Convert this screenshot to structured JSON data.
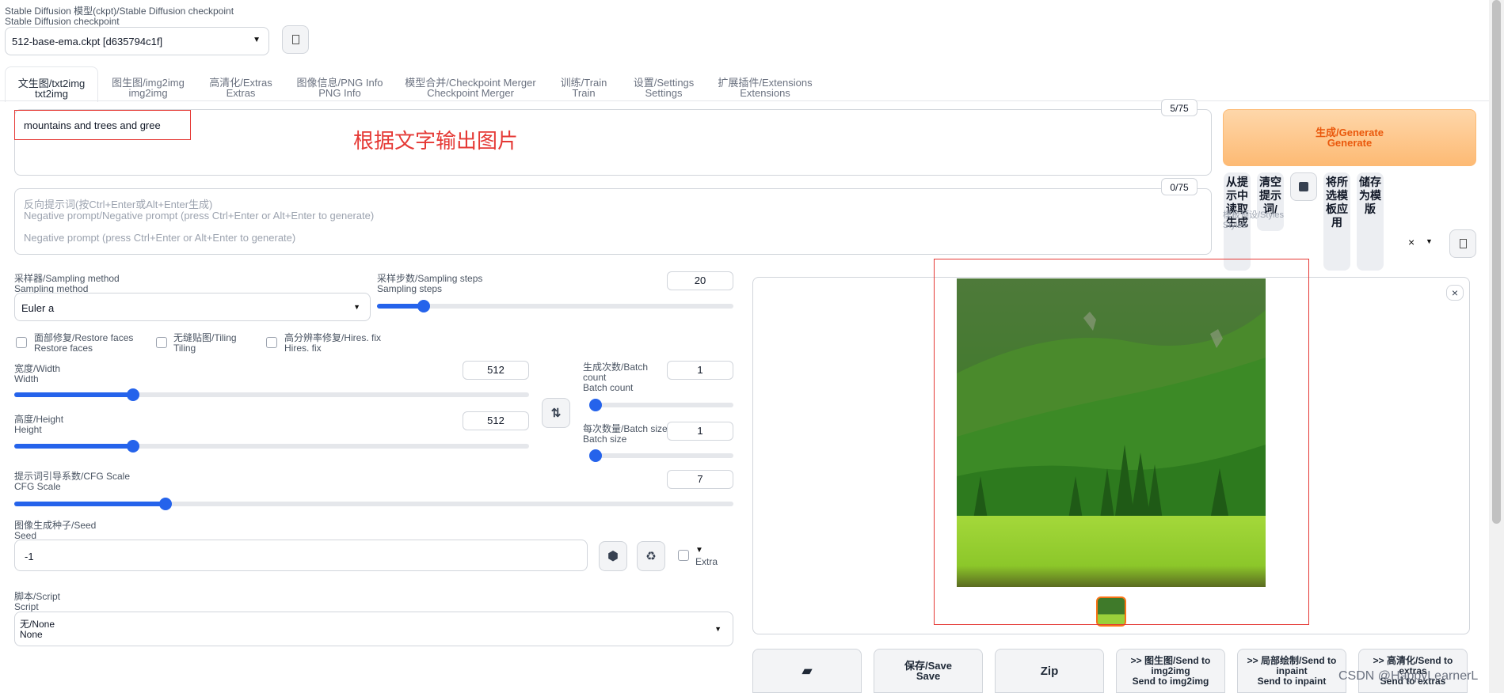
{
  "checkpoint": {
    "label_cn": "Stable Diffusion 模型(ckpt)/Stable Diffusion checkpoint",
    "label_en": "Stable Diffusion checkpoint",
    "value": "512-base-ema.ckpt [d635794c1f]"
  },
  "tabs": [
    {
      "cn": "文生图/txt2img",
      "en": "txt2img"
    },
    {
      "cn": "图生图/img2img",
      "en": "img2img"
    },
    {
      "cn": "高清化/Extras",
      "en": "Extras"
    },
    {
      "cn": "图像信息/PNG Info",
      "en": "PNG Info"
    },
    {
      "cn": "模型合并/Checkpoint Merger",
      "en": "Checkpoint Merger"
    },
    {
      "cn": "训练/Train",
      "en": "Train"
    },
    {
      "cn": "设置/Settings",
      "en": "Settings"
    },
    {
      "cn": "扩展插件/Extensions",
      "en": "Extensions"
    }
  ],
  "prompt": {
    "value": "mountains and trees and gree",
    "counter": "5/75",
    "annotation": "根据文字输出图片"
  },
  "negative_prompt": {
    "counter": "0/75",
    "ph1": "反向提示词(按Ctrl+Enter或Alt+Enter生成)",
    "ph2": "Negative prompt/Negative prompt (press Ctrl+Enter or Alt+Enter to generate)",
    "ph3": "Negative prompt (press Ctrl+Enter or Alt+Enter to generate)"
  },
  "generate": {
    "cn": "生成/Generate",
    "en": "Generate"
  },
  "tool_buttons": {
    "from_prompt": "从提示中读取生成",
    "clear": "清空提示词/",
    "apply_style": "将所选模板应用",
    "save_style": "储存为模版"
  },
  "styles": {
    "label_cn": "模板预设/Styles",
    "label_en": "Styles",
    "clear": "×"
  },
  "sampling": {
    "method_label_cn": "采样器/Sampling method",
    "method_label_en": "Sampling method",
    "method_value": "Euler a",
    "steps_label_cn": "采样步数/Sampling steps",
    "steps_label_en": "Sampling steps",
    "steps_value": "20",
    "steps_fraction": 0.13
  },
  "checkboxes": [
    {
      "cn": "面部修复/Restore faces",
      "en": "Restore faces"
    },
    {
      "cn": "无缝贴图/Tiling",
      "en": "Tiling"
    },
    {
      "cn": "高分辨率修复/Hires. fix",
      "en": "Hires. fix"
    }
  ],
  "width": {
    "label_cn": "宽度/Width",
    "label_en": "Width",
    "value": "512",
    "fraction": 0.23
  },
  "height": {
    "label_cn": "高度/Height",
    "label_en": "Height",
    "value": "512",
    "fraction": 0.23
  },
  "batch_count": {
    "label_cn": "生成次数/Batch count",
    "label_en": "Batch count",
    "value": "1",
    "fraction": 0.0
  },
  "batch_size": {
    "label_cn": "每次数量/Batch size",
    "label_en": "Batch size",
    "value": "1",
    "fraction": 0.0
  },
  "cfg": {
    "label_cn": "提示词引导系数/CFG Scale",
    "label_en": "CFG Scale",
    "value": "7",
    "fraction": 0.21
  },
  "seed": {
    "label_cn": "图像生成种子/Seed",
    "label_en": "Seed",
    "value": "-1",
    "extra": "Extra"
  },
  "script": {
    "label_cn": "脚本/Script",
    "label_en": "Script",
    "value_cn": "无/None",
    "value_en": "None"
  },
  "close_glyph": "×",
  "bottom_buttons": [
    {
      "line1": "保存/Save",
      "line2": "Save"
    },
    {
      "line1": "Zip",
      "line2": ""
    },
    {
      "line1": ">> 图生图/Send to img2img",
      "line2": "Send to img2img"
    },
    {
      "line1": ">> 局部绘制/Send to inpaint",
      "line2": "Send to inpaint"
    },
    {
      "line1": ">> 高清化/Send to extras",
      "line2": "Send to extras"
    }
  ],
  "watermark": "CSDN @HappyLearnerL",
  "colors": {
    "accent": "#2563eb",
    "generate_bg": "#fdba74",
    "generate_text": "#ea580c",
    "annotation_red": "#e53935"
  }
}
